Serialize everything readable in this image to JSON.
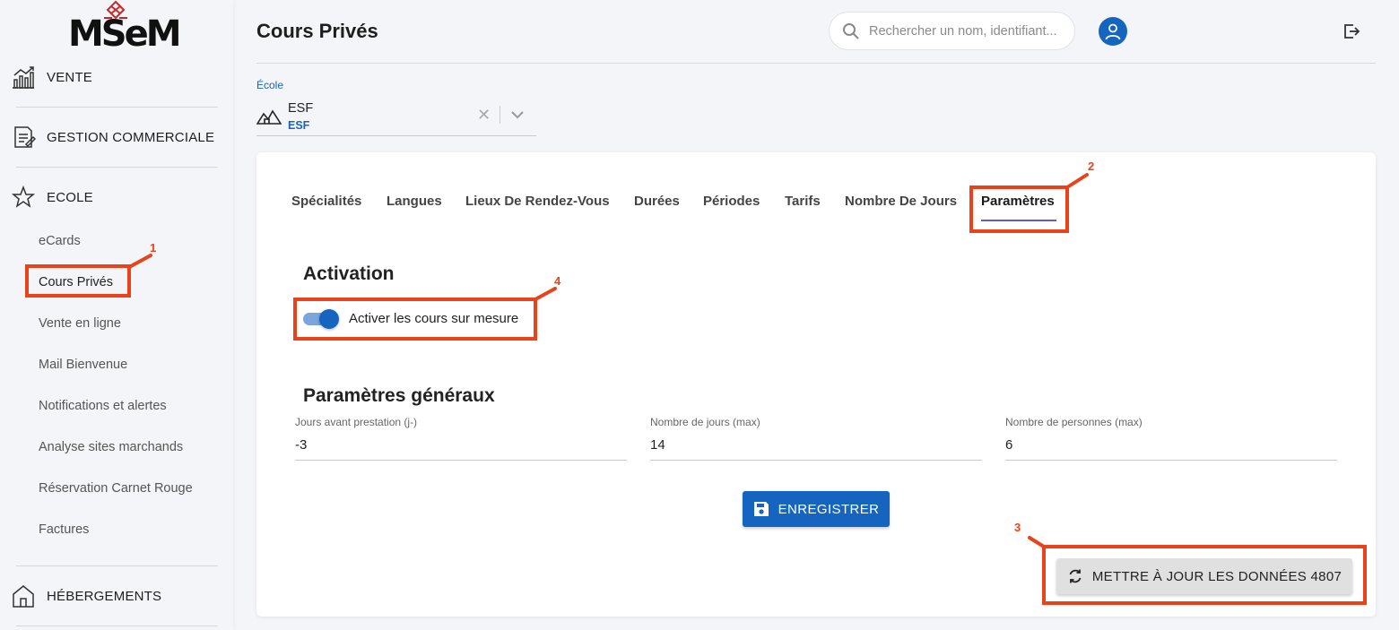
{
  "sidebar": {
    "logo_text": "MSeM",
    "sections": [
      {
        "label": "VENTE",
        "icon": "chart-bars-icon"
      },
      {
        "label": "GESTION COMMERCIALE",
        "icon": "document-edit-icon"
      },
      {
        "label": "ECOLE",
        "icon": "star-icon"
      },
      {
        "label": "HÉBERGEMENTS",
        "icon": "house-icon"
      }
    ],
    "ecole_items": [
      "eCards",
      "Cours Privés",
      "Vente en ligne",
      "Mail Bienvenue",
      "Notifications et alertes",
      "Analyse sites marchands",
      "Réservation Carnet Rouge",
      "Factures"
    ],
    "active_item": "Cours Privés"
  },
  "header": {
    "title": "Cours Privés",
    "search_placeholder": "Rechercher un nom, identifiant...",
    "search_icon": "search-icon",
    "avatar_icon": "user-icon",
    "logout_icon": "logout-icon"
  },
  "school": {
    "label": "École",
    "name": "ESF",
    "code": "ESF",
    "icon": "mountain-house-icon",
    "clear_icon": "close-icon",
    "dropdown_icon": "chevron-down-icon"
  },
  "tabs": [
    {
      "label": "Spécialités"
    },
    {
      "label": "Langues"
    },
    {
      "label": "Lieux De Rendez-Vous"
    },
    {
      "label": "Durées"
    },
    {
      "label": "Périodes"
    },
    {
      "label": "Tarifs"
    },
    {
      "label": "Nombre De Jours"
    },
    {
      "label": "Paramètres",
      "active": true
    }
  ],
  "activation": {
    "title": "Activation",
    "toggle_label": "Activer les cours sur mesure",
    "toggle_on": true
  },
  "general": {
    "title": "Paramètres généraux",
    "fields": [
      {
        "label": "Jours avant prestation (j-)",
        "value": "-3"
      },
      {
        "label": "Nombre de jours (max)",
        "value": "14"
      },
      {
        "label": "Nombre de personnes (max)",
        "value": "6"
      }
    ]
  },
  "buttons": {
    "save": "ENREGISTRER",
    "save_icon": "floppy-disk-icon",
    "update": "METTRE À JOUR LES DONNÉES 4807",
    "update_icon": "refresh-icon"
  },
  "annotations": [
    "1",
    "2",
    "3",
    "4"
  ],
  "colors": {
    "primary": "#1565c0",
    "annotation": "#e8431a",
    "tab_underline": "#5e5bdc"
  }
}
